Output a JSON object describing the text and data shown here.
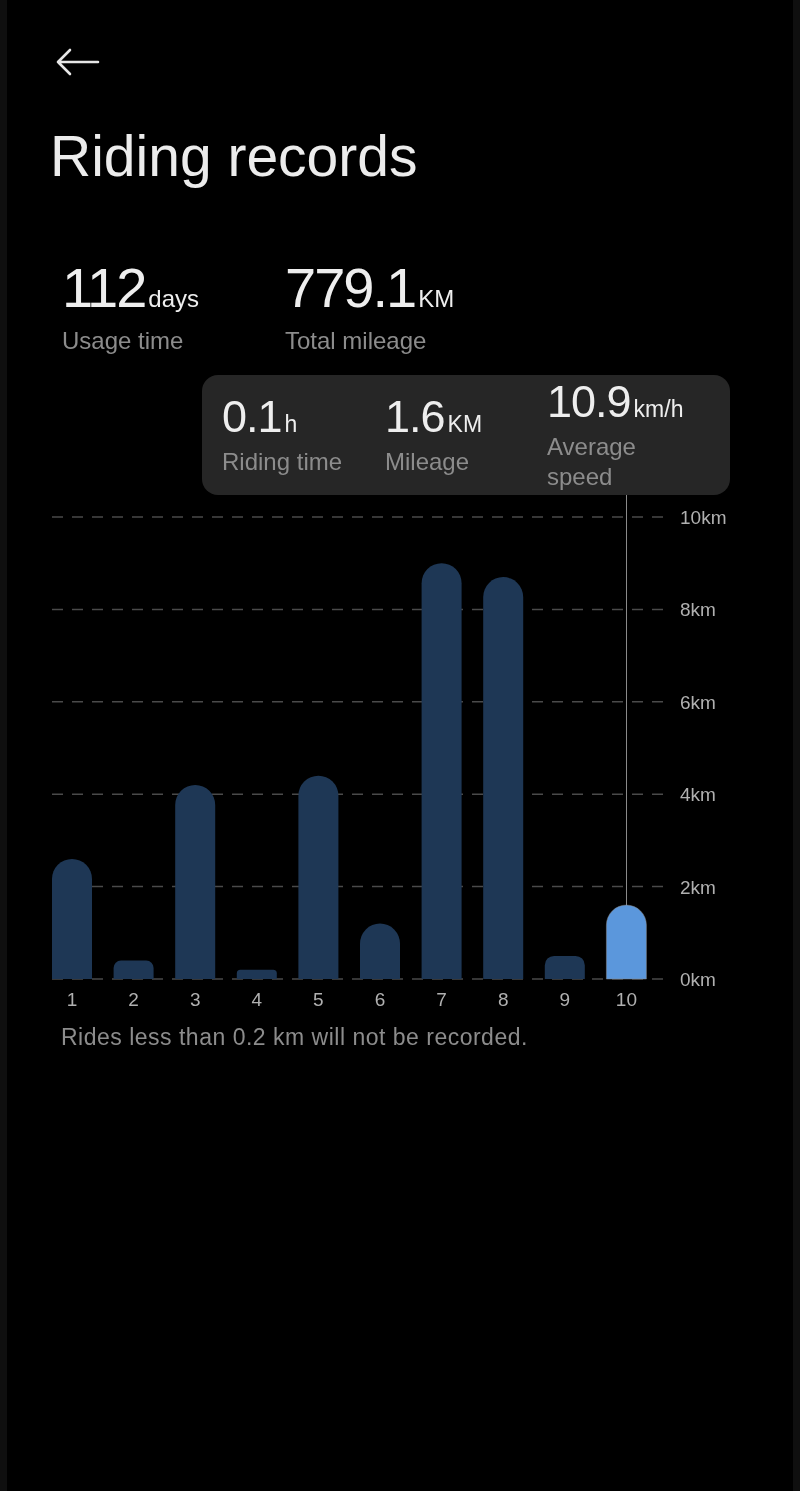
{
  "header": {
    "title": "Riding records"
  },
  "summary": [
    {
      "value": "112",
      "unit": "days",
      "label": "Usage time"
    },
    {
      "value": "779.1",
      "unit": "KM",
      "label": "Total mileage"
    }
  ],
  "chart": {
    "details": [
      {
        "value": "0.1",
        "unit": "h",
        "label": "Riding time"
      },
      {
        "value": "1.6",
        "unit": "KM",
        "label": "Mileage"
      },
      {
        "value": "10.9",
        "unit": "km/h",
        "label": "Average speed"
      }
    ],
    "bars": [
      {
        "selected": false
      },
      {
        "selected": false
      },
      {
        "selected": false
      },
      {
        "selected": false
      },
      {
        "selected": false
      },
      {
        "selected": false
      },
      {
        "selected": false
      },
      {
        "selected": false
      },
      {
        "selected": false
      },
      {
        "selected": true
      }
    ],
    "chart_data": {
      "type": "bar",
      "grid": true,
      "stacked": true,
      "categories": [
        "1",
        "2",
        "3",
        "4",
        "5",
        "6",
        "7",
        "8",
        "9",
        "10"
      ],
      "series": [
        {
          "color": "#1e3755",
          "values": [
            2.6,
            0.4,
            4.2,
            0.2,
            4.4,
            1.2,
            9.0,
            8.7,
            0.5,
            null
          ]
        },
        {
          "color": "#5b97dc",
          "values": [
            null,
            null,
            null,
            null,
            null,
            null,
            null,
            null,
            null,
            1.6
          ]
        }
      ],
      "ylim": [
        0,
        10
      ],
      "yticks": [
        {
          "value": 0,
          "label": "0km"
        },
        {
          "value": 2,
          "label": "2km"
        },
        {
          "value": 4,
          "label": "4km"
        },
        {
          "value": 6,
          "label": "6km"
        },
        {
          "value": 8,
          "label": "8km"
        },
        {
          "value": 10,
          "label": "10km"
        }
      ]
    }
  },
  "note": "Rides less than 0.2 km will not be recorded."
}
